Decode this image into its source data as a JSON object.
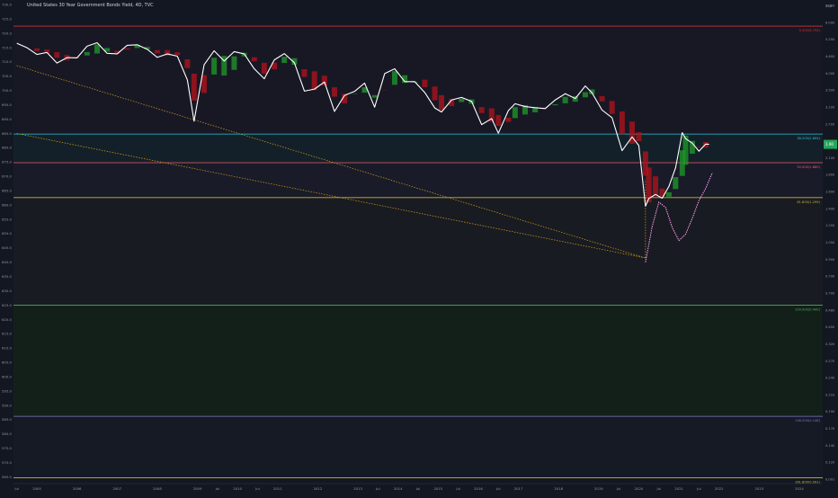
{
  "colors": {
    "background": "#131722",
    "price": "#ffffff",
    "ribbon_up": "#1f9b2a",
    "ribbon_down": "#b5121b",
    "forecast": "#ff9ff3",
    "trendline": "#d4a017",
    "price_label_bg": "#26a65b"
  },
  "chart_data": {
    "type": "line",
    "title": "United States 30 Year Government Bonds Yield, 4D, TVC",
    "left_axis": {
      "ticks": [
        "730.0",
        "725.0",
        "720.0",
        "715.0",
        "710.0",
        "705.0",
        "700.0",
        "695.0",
        "690.0",
        "685.0",
        "680.0",
        "675.0",
        "670.0",
        "665.0",
        "660.0",
        "655.0",
        "650.0",
        "645.0",
        "640.0",
        "635.0",
        "630.0",
        "625.0",
        "620.0",
        "615.0",
        "610.0",
        "605.0",
        "600.0",
        "595.0",
        "590.0",
        "585.0",
        "580.0",
        "575.0",
        "570.0",
        "565.0"
      ],
      "range": [
        563.0,
        731.0
      ]
    },
    "right_axis": {
      "scale": "log",
      "ticks": [
        "7.000",
        "6.000",
        "5.200",
        "4.600",
        "4.000",
        "3.500",
        "3.100",
        "2.700",
        "2.400",
        "2.100",
        "1.800",
        "1.600",
        "1.400",
        "1.200",
        "1.050",
        "0.900",
        "0.790",
        "0.700",
        "0.480",
        "0.400",
        "0.320",
        "0.270",
        "0.240",
        "0.210",
        "0.190",
        "0.170",
        "0.140",
        "0.120",
        "0.091"
      ],
      "currency_label": "USD",
      "price_label": "1.90"
    },
    "x_axis": {
      "tick_labels": [
        "Jul",
        "2005",
        "2006",
        "2007",
        "2008",
        "2009",
        "Jul",
        "2010",
        "Jul",
        "2011",
        "2012",
        "2013",
        "Jul",
        "2014",
        "Jul",
        "2015",
        "Jul",
        "2016",
        "Jul",
        "2017",
        "2018",
        "2019",
        "Jul",
        "2020",
        "Jul",
        "2021",
        "Jul",
        "2022",
        "2023",
        "2024"
      ],
      "tick_dates": [
        "2004-07",
        "2005-01",
        "2006-01",
        "2007-01",
        "2008-01",
        "2009-01",
        "2009-07",
        "2010-01",
        "2010-07",
        "2011-01",
        "2012-01",
        "2013-01",
        "2013-07",
        "2014-01",
        "2014-07",
        "2015-01",
        "2015-07",
        "2016-01",
        "2016-07",
        "2017-01",
        "2018-01",
        "2019-01",
        "2019-07",
        "2020-01",
        "2020-07",
        "2021-01",
        "2021-07",
        "2022-01",
        "2023-01",
        "2024-01"
      ],
      "range": [
        "2004-06",
        "2024-08"
      ]
    },
    "fib_levels": [
      {
        "label": "0.000(6.794)",
        "value": 722.5,
        "color": "#d0312d"
      },
      {
        "label": "38.200(2.604)",
        "value": 684.8,
        "color": "#26c6da"
      },
      {
        "label": "50.000(1.880)",
        "value": 674.8,
        "color": "#f05c6e"
      },
      {
        "label": "61.800(1.299)",
        "value": 662.6,
        "color": "#c9b037"
      },
      {
        "label": "100.000(0.440)",
        "value": 625.0,
        "color": "#4caf50"
      },
      {
        "label": "138.200(0.148)",
        "value": 586.2,
        "color": "#7e78c4"
      },
      {
        "label": "161.800(0.091)",
        "value": 564.7,
        "color": "#c8b82f"
      }
    ],
    "trendlines": [
      {
        "x": [
          "2004-07",
          "2020-03"
        ],
        "y": [
          708.7,
          641.5
        ]
      },
      {
        "x": [
          "2004-07",
          "2020-03"
        ],
        "y": [
          685.0,
          641.5
        ]
      },
      {
        "x": [
          "2020-03",
          "2020-03"
        ],
        "y": [
          641.5,
          669.0
        ]
      }
    ],
    "price_series": {
      "x": [
        "2004-07",
        "2004-10",
        "2005-01",
        "2005-04",
        "2005-07",
        "2005-10",
        "2006-01",
        "2006-04",
        "2006-07",
        "2006-10",
        "2007-01",
        "2007-04",
        "2007-07",
        "2007-10",
        "2008-01",
        "2008-04",
        "2008-07",
        "2008-10",
        "2008-12",
        "2009-03",
        "2009-06",
        "2009-09",
        "2009-12",
        "2010-03",
        "2010-06",
        "2010-09",
        "2010-12",
        "2011-03",
        "2011-06",
        "2011-09",
        "2011-12",
        "2012-03",
        "2012-06",
        "2012-09",
        "2012-12",
        "2013-03",
        "2013-06",
        "2013-09",
        "2013-12",
        "2014-03",
        "2014-06",
        "2014-09",
        "2014-12",
        "2015-02",
        "2015-05",
        "2015-08",
        "2015-11",
        "2016-02",
        "2016-05",
        "2016-07",
        "2016-10",
        "2016-12",
        "2017-03",
        "2017-06",
        "2017-09",
        "2017-12",
        "2018-03",
        "2018-06",
        "2018-09",
        "2018-11",
        "2019-02",
        "2019-05",
        "2019-08",
        "2019-11",
        "2020-01",
        "2020-03",
        "2020-04",
        "2020-06",
        "2020-08",
        "2020-10",
        "2020-12",
        "2021-02",
        "2021-03",
        "2021-05",
        "2021-07",
        "2021-09",
        "2021-10"
      ],
      "y": [
        716.5,
        715.0,
        712.6,
        713.3,
        709.6,
        711.5,
        711.4,
        715.5,
        716.7,
        713.0,
        712.8,
        715.8,
        716.0,
        714.4,
        711.6,
        712.8,
        712.0,
        703.7,
        689.3,
        709.0,
        713.9,
        710.3,
        713.6,
        712.8,
        707.6,
        704.1,
        710.7,
        712.9,
        709.7,
        699.8,
        700.5,
        703.0,
        692.7,
        698.3,
        699.7,
        702.6,
        694.2,
        705.9,
        707.6,
        703.1,
        703.1,
        699.3,
        693.9,
        692.5,
        696.7,
        697.6,
        696.2,
        688.1,
        690.2,
        685.1,
        693.0,
        695.4,
        694.4,
        694.0,
        693.7,
        696.7,
        698.9,
        697.2,
        701.6,
        699.2,
        693.2,
        690.5,
        679.0,
        683.8,
        680.8,
        659.6,
        662.3,
        663.7,
        662.4,
        666.5,
        673.0,
        685.3,
        683.2,
        681.6,
        678.8,
        681.3,
        681.2
      ]
    },
    "forecast_series": {
      "x": [
        "2020-03",
        "2020-05",
        "2020-07",
        "2020-09",
        "2020-11",
        "2021-01",
        "2021-03",
        "2021-05",
        "2021-07",
        "2021-09",
        "2021-11"
      ],
      "y": [
        640.0,
        652.5,
        661.0,
        659.2,
        652.1,
        647.6,
        649.8,
        655.4,
        661.6,
        665.8,
        671.3
      ]
    }
  }
}
